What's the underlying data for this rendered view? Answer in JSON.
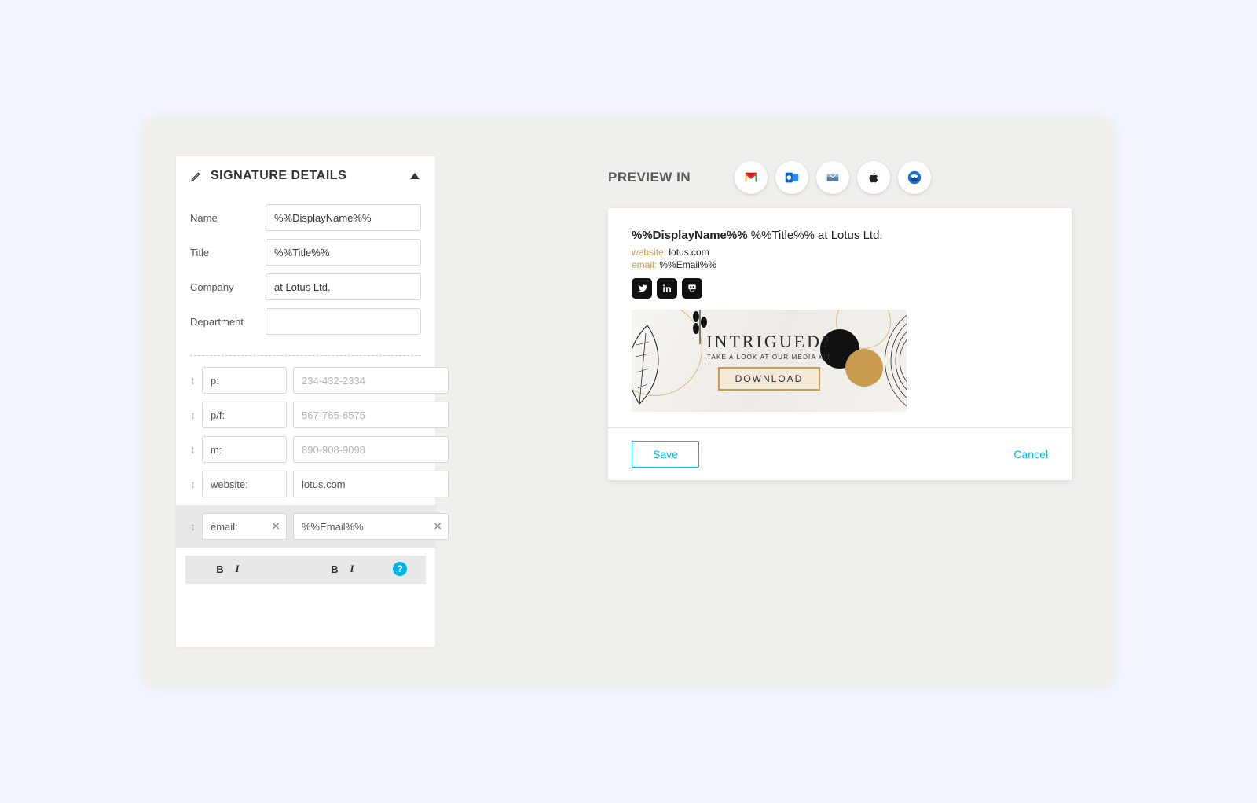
{
  "panel": {
    "title": "SIGNATURE DETAILS",
    "fields": {
      "name": {
        "label": "Name",
        "value": "%%DisplayName%%"
      },
      "title": {
        "label": "Title",
        "value": "%%Title%%"
      },
      "company": {
        "label": "Company",
        "value": "at Lotus Ltd."
      },
      "department": {
        "label": "Department",
        "value": ""
      }
    },
    "contacts": [
      {
        "label": "p:",
        "placeholder": "234-432-2334",
        "value": ""
      },
      {
        "label": "p/f:",
        "placeholder": "567-765-6575",
        "value": ""
      },
      {
        "label": "m:",
        "placeholder": "890-908-9098",
        "value": ""
      },
      {
        "label": "website:",
        "value": "lotus.com"
      },
      {
        "label": "email:",
        "value": "%%Email%%"
      }
    ]
  },
  "preview": {
    "heading": "PREVIEW IN",
    "clients": [
      "gmail",
      "outlook",
      "mac-mail",
      "apple",
      "thunderbird"
    ],
    "signature": {
      "name": "%%DisplayName%%",
      "rest": "%%Title%% at Lotus Ltd.",
      "lines": [
        {
          "key": "website:",
          "val": "lotus.com"
        },
        {
          "key": "email:",
          "val": "%%Email%%"
        }
      ],
      "social": [
        "twitter",
        "linkedin",
        "slideshare"
      ]
    },
    "banner": {
      "title": "INTRIGUED?",
      "sub": "TAKE A LOOK AT OUR MEDIA KIT",
      "button": "DOWNLOAD"
    },
    "save": "Save",
    "cancel": "Cancel"
  }
}
